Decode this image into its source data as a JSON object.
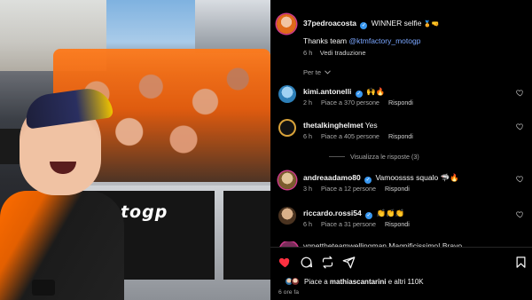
{
  "post": {
    "author": "37pedroacosta",
    "caption": "WINNER selfie",
    "caption_emojis": "🏅🤜",
    "thanks_text": "Thanks team",
    "mention": "@ktmfactory_motogp",
    "time": "6 h",
    "translate_label": "Vedi traduzione",
    "for_you_label": "Per te",
    "photo_banner_text": "Motogp"
  },
  "comments": [
    {
      "user": "kimi.antonelli",
      "verified": true,
      "text": "🙌🔥",
      "time": "2 h",
      "likes": "Piace a 370 persone",
      "reply": "Rispondi",
      "avatar_color": "#2d7fb8"
    },
    {
      "user": "thetalkinghelmet",
      "verified": false,
      "text": "Yes",
      "time": "6 h",
      "likes": "Piace a 405 persone",
      "reply": "Rispondi",
      "avatar_color": "#3a3a3a"
    },
    {
      "user": "andreaadamo80",
      "verified": true,
      "text": "Vamoossss squalo 🦈🔥",
      "time": "3 h",
      "likes": "Piace a 12 persone",
      "reply": "Rispondi",
      "avatar_color": "#b58a3c"
    },
    {
      "user": "riccardo.rossi54",
      "verified": true,
      "text": "👏👏👏",
      "time": "6 h",
      "likes": "Piace a 31 persone",
      "reply": "Rispondi",
      "avatar_color": "#6b4a2e"
    }
  ],
  "view_replies_label": "Visualizza le risposte (3)",
  "cut_comment_text": "vgnettheteamwellingman Magnificissimo! Bravo",
  "likes_summary": {
    "prefix": "Piace a",
    "user": "mathiascantarini",
    "suffix": "e altri 110K"
  },
  "post_age": "6 ore fa",
  "colors": {
    "accent_like": "#ff3040",
    "mention": "#7aa6ff",
    "verified": "#3897f0",
    "background": "#000000"
  },
  "icons": [
    "heart-icon",
    "comment-icon",
    "repost-icon",
    "share-icon",
    "bookmark-icon",
    "verified-icon",
    "chevron-down-icon"
  ]
}
